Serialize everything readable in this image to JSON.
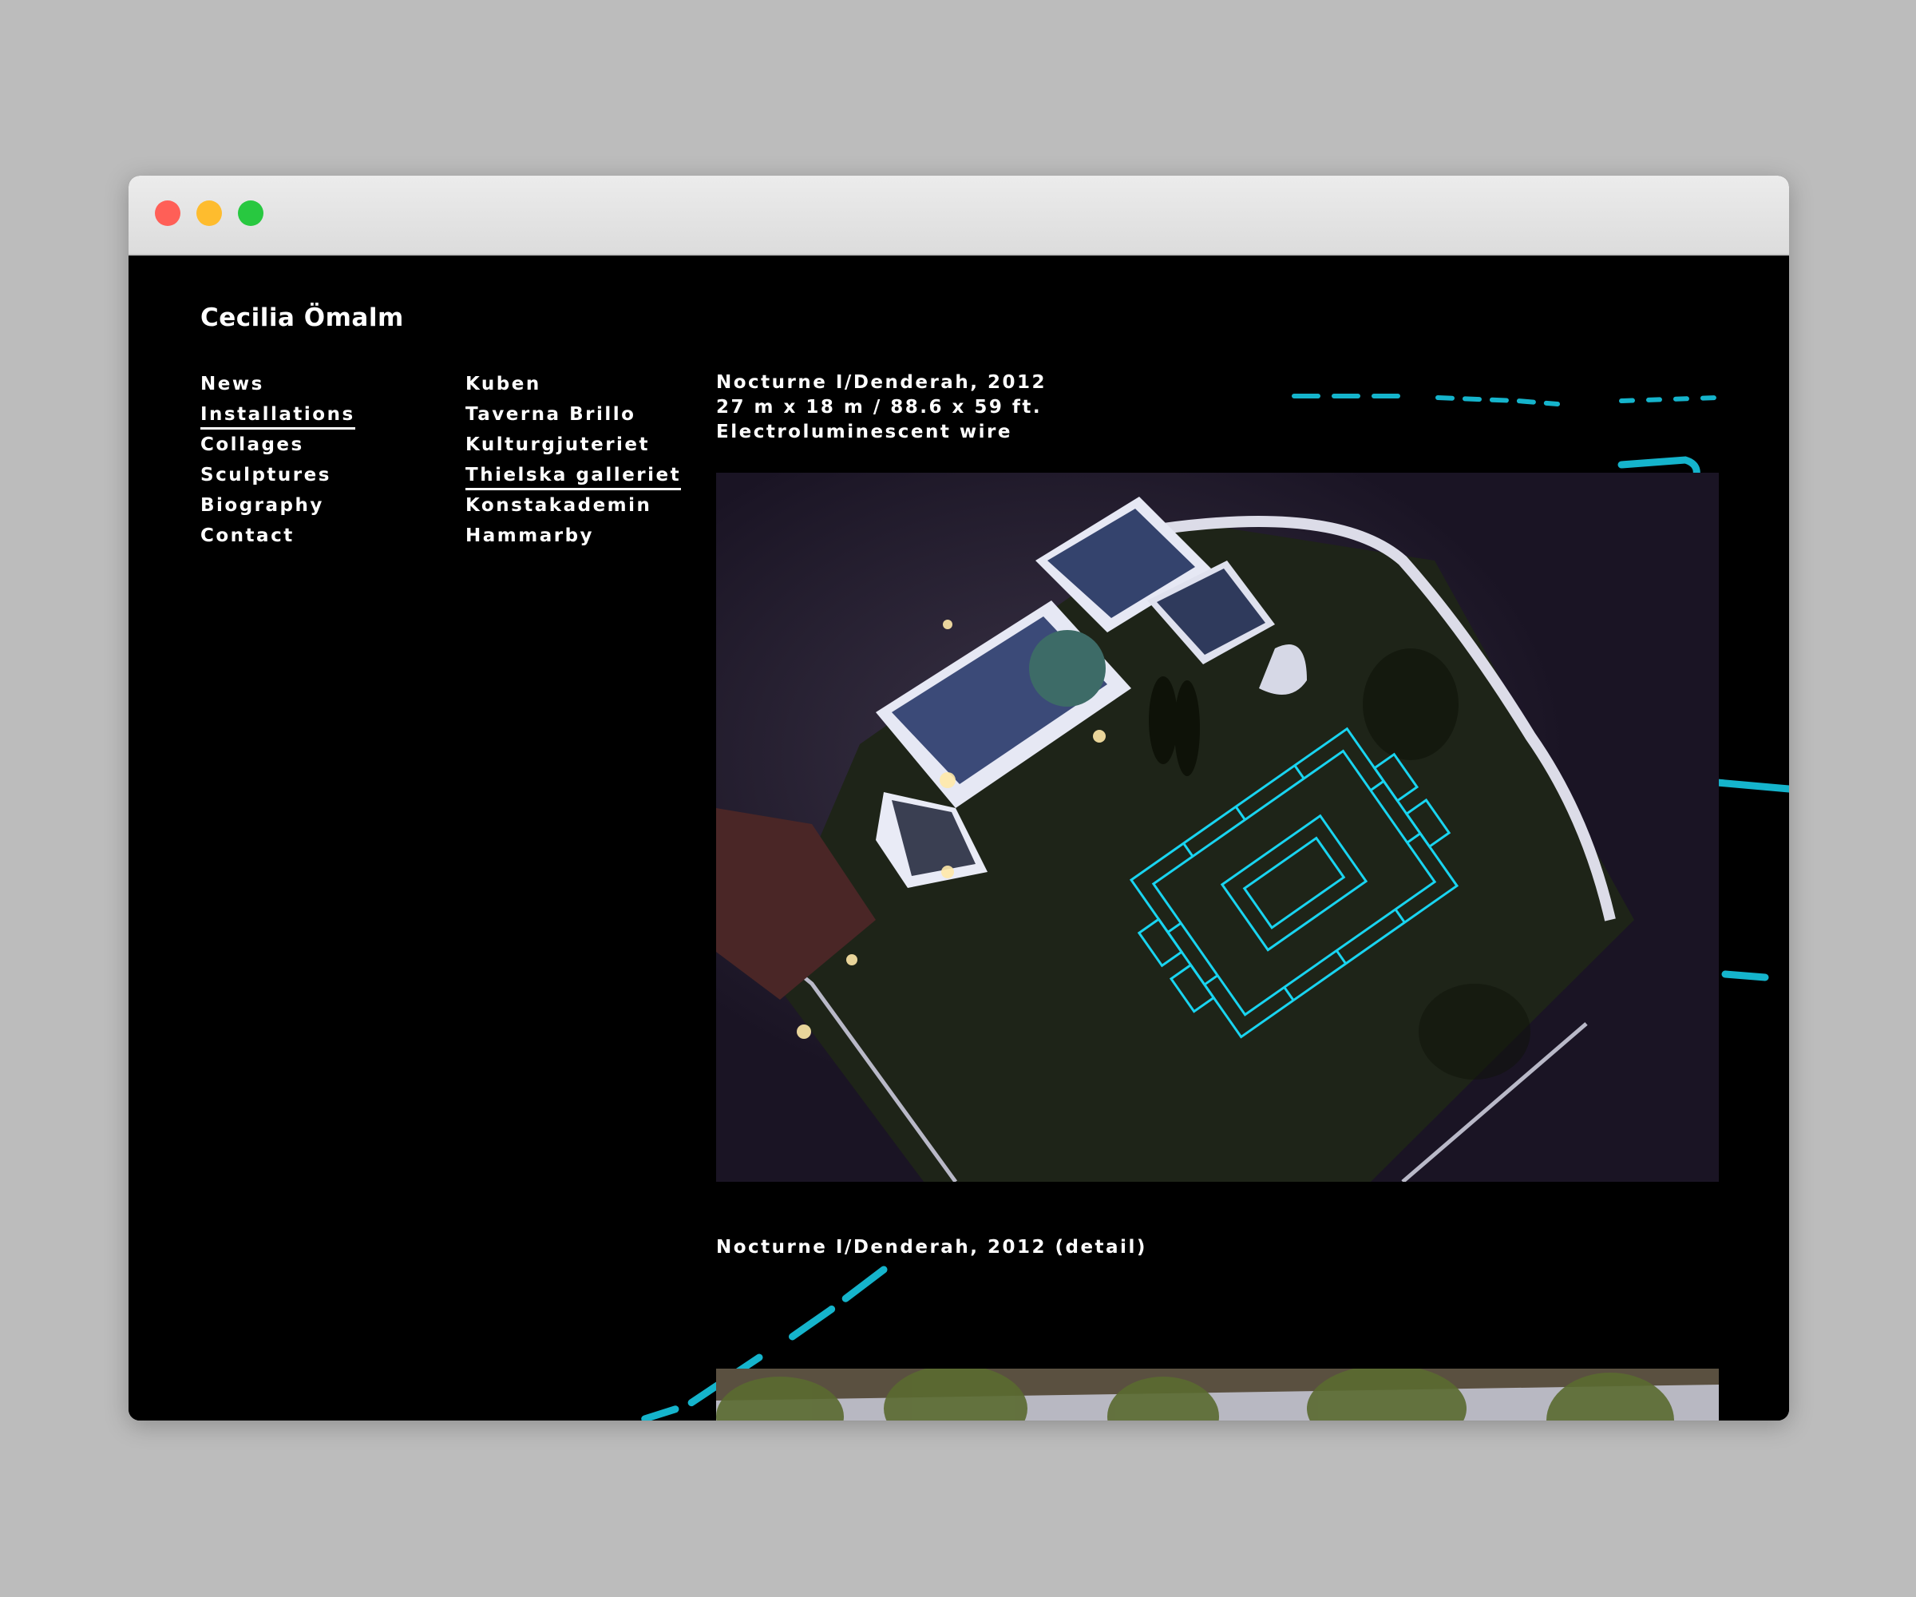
{
  "window": {
    "controls": [
      "close",
      "minimize",
      "maximize"
    ]
  },
  "site": {
    "title": "Cecilia Ömalm"
  },
  "nav_primary": {
    "items": [
      {
        "label": "News",
        "active": false
      },
      {
        "label": "Installations",
        "active": true
      },
      {
        "label": "Collages",
        "active": false
      },
      {
        "label": "Sculptures",
        "active": false
      },
      {
        "label": "Biography",
        "active": false
      },
      {
        "label": "Contact",
        "active": false
      }
    ]
  },
  "nav_secondary": {
    "items": [
      {
        "label": "Kuben",
        "active": false
      },
      {
        "label": "Taverna Brillo",
        "active": false
      },
      {
        "label": "Kulturgjuteriet",
        "active": false
      },
      {
        "label": "Thielska galleriet",
        "active": true
      },
      {
        "label": "Konstakademin",
        "active": false
      },
      {
        "label": "Hammarby",
        "active": false
      }
    ]
  },
  "work": {
    "title": "Nocturne I/Denderah, 2012",
    "dimensions": "27 m x 18 m / 88.6 x 59 ft.",
    "material": "Electroluminescent wire",
    "detail_caption": "Nocturne I/Denderah, 2012 (detail)"
  },
  "colors": {
    "page_bg": "#000000",
    "text": "#ffffff",
    "wire_accent": "#19d4f0",
    "desktop_bg": "#bcbcbc"
  }
}
